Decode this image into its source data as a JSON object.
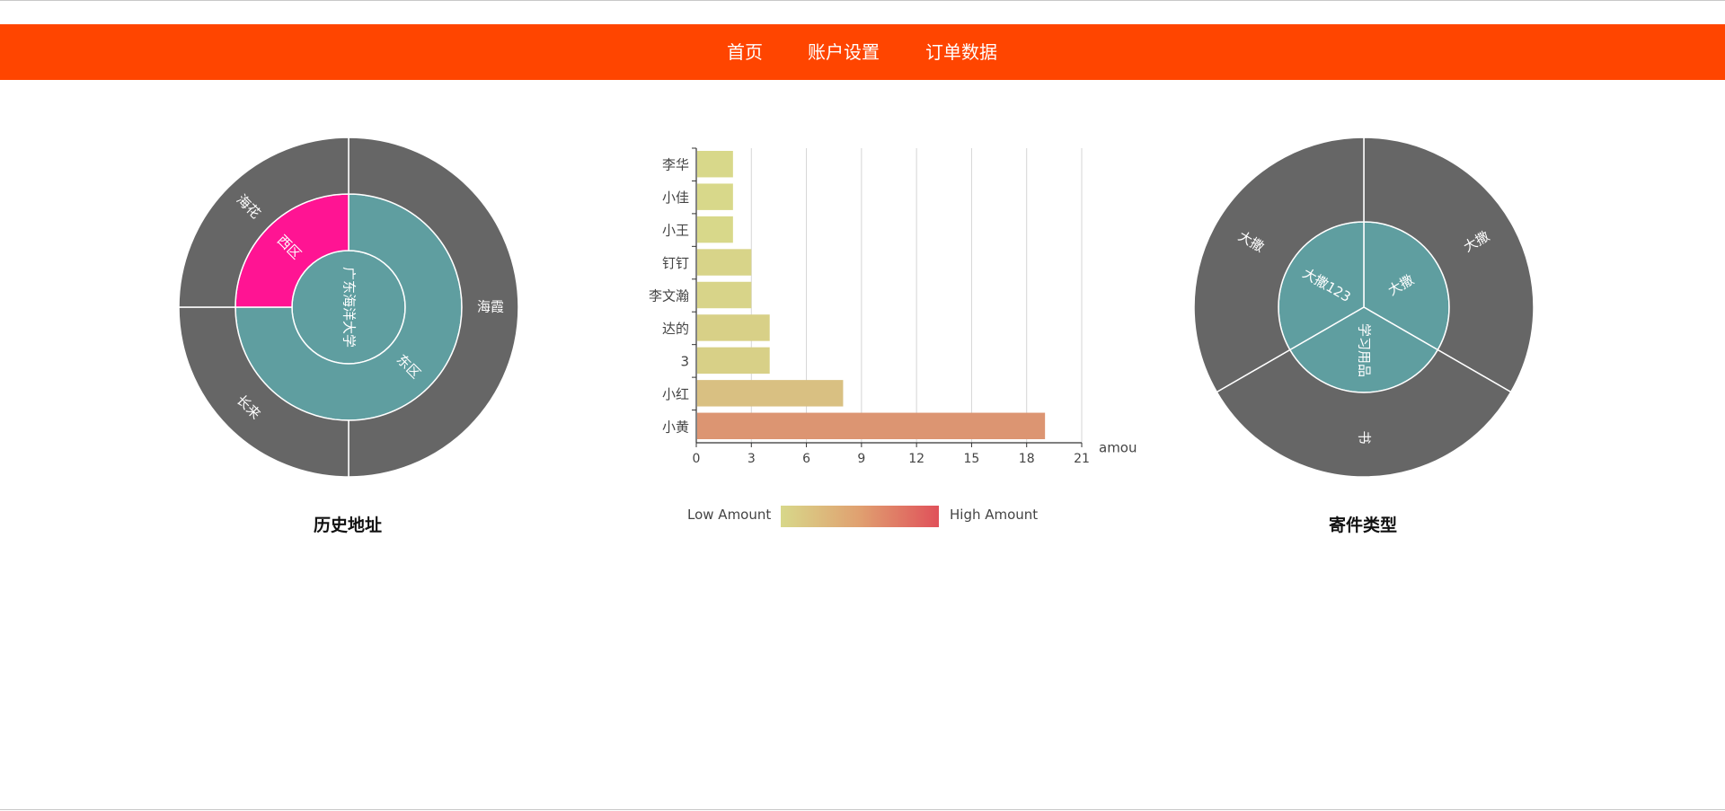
{
  "nav": {
    "home": "首页",
    "account": "账户设置",
    "orders": "订单数据"
  },
  "colors": {
    "brand": "#ff4500",
    "sunburst_dark": "#666666",
    "sunburst_teal": "#5f9ea0",
    "sunburst_pink": "#ff1493"
  },
  "chart_data": [
    {
      "type": "sunburst",
      "title": "历史地址",
      "levels": [
        {
          "name": "广东海洋大学",
          "ring": "inner",
          "value": 1
        },
        {
          "name": "西区",
          "ring": "middle",
          "parent": "广东海洋大学",
          "value": 0.25
        },
        {
          "name": "东区",
          "ring": "middle",
          "parent": "广东海洋大学",
          "value": 0.75
        },
        {
          "name": "海花",
          "ring": "outer",
          "parent": "西区",
          "value": 0.25
        },
        {
          "name": "海霞",
          "ring": "outer",
          "parent": "东区",
          "value": 0.5
        },
        {
          "name": "长来",
          "ring": "outer",
          "parent": "东区",
          "value": 0.25
        }
      ]
    },
    {
      "type": "bar",
      "orientation": "horizontal",
      "categories": [
        "李华",
        "小佳",
        "小王",
        "钉钉",
        "李文瀚",
        "达的",
        "3",
        "小红",
        "小黄"
      ],
      "values": [
        2,
        2,
        2,
        3,
        3,
        4,
        4,
        8,
        19
      ],
      "xlabel": "amou",
      "xticks": [
        "0",
        "3",
        "6",
        "9",
        "12",
        "15",
        "18",
        "21"
      ],
      "xlim": [
        0,
        21
      ],
      "grid": true,
      "visual_map": {
        "low_label": "Low Amount",
        "high_label": "High Amount",
        "low_color": "#d8d88a",
        "high_color": "#e0515a"
      }
    },
    {
      "type": "sunburst",
      "title": "寄件类型",
      "levels": [
        {
          "name": "学习用品",
          "ring": "inner",
          "value": 0.3333
        },
        {
          "name": "大撒123",
          "ring": "inner",
          "value": 0.3333
        },
        {
          "name": "大撒",
          "ring": "inner",
          "value": 0.3333
        },
        {
          "name": "书",
          "ring": "outer",
          "parent": "学习用品",
          "value": 0.3333
        },
        {
          "name": "大撒",
          "ring": "outer",
          "parent": "大撒123",
          "value": 0.3333
        },
        {
          "name": "大撒",
          "ring": "outer",
          "parent": "大撒",
          "value": 0.3333
        }
      ]
    }
  ]
}
